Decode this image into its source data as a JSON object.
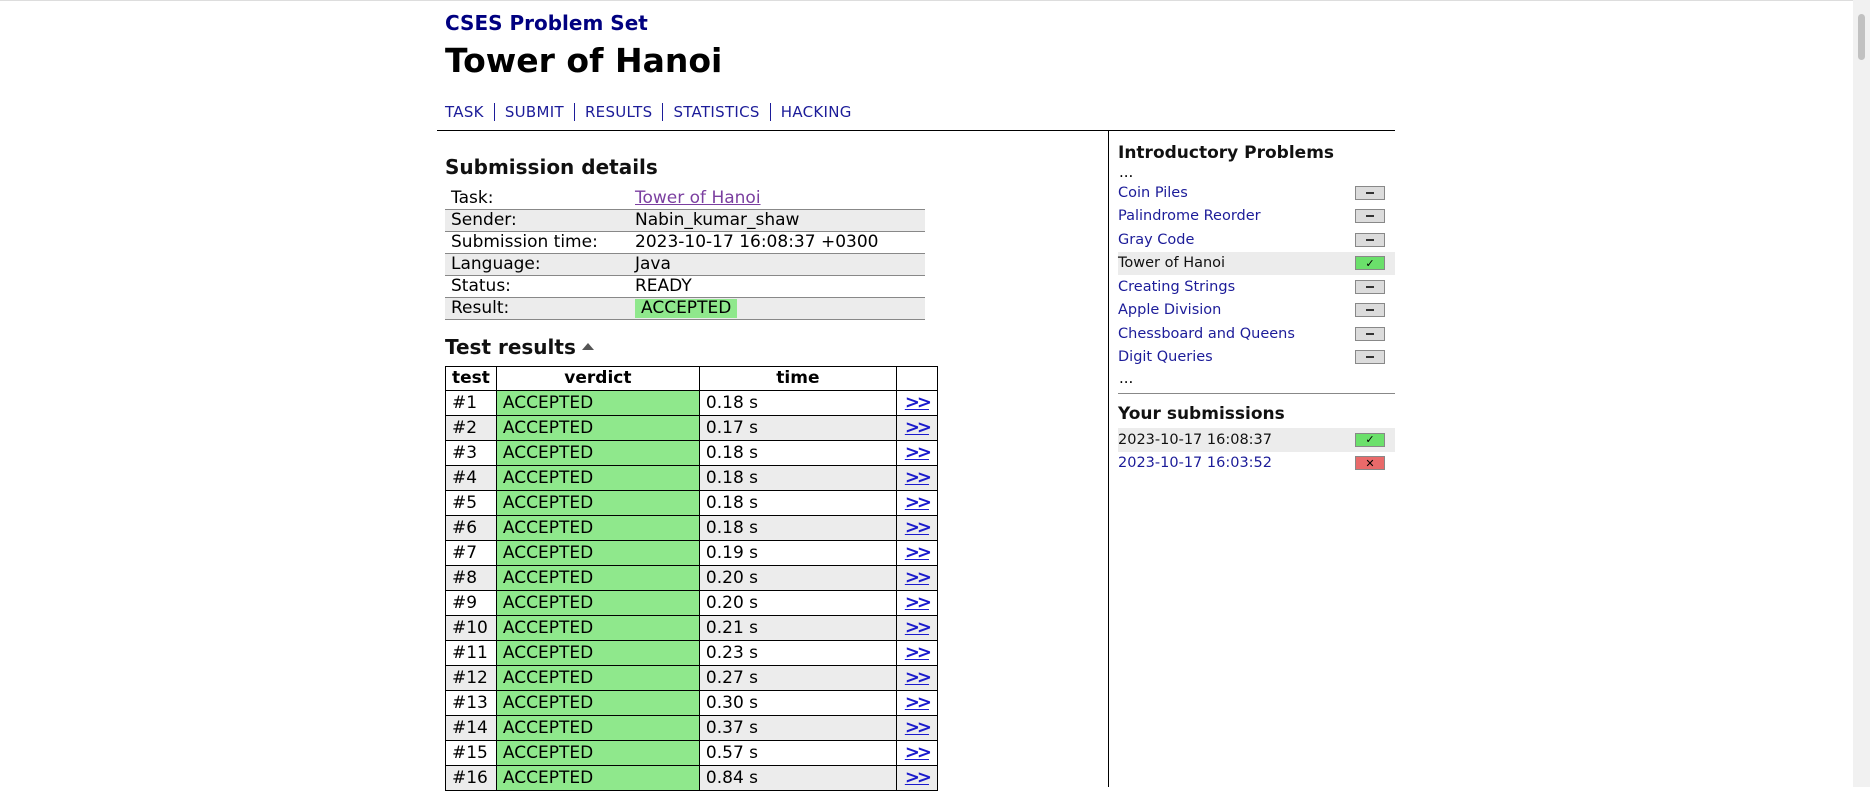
{
  "site": {
    "title": "CSES Problem Set"
  },
  "page": {
    "title": "Tower of Hanoi"
  },
  "nav": [
    "TASK",
    "SUBMIT",
    "RESULTS",
    "STATISTICS",
    "HACKING"
  ],
  "details": {
    "heading": "Submission details",
    "rows": [
      {
        "label": "Task:",
        "value": "Tower of Hanoi"
      },
      {
        "label": "Sender:",
        "value": "Nabin_kumar_shaw"
      },
      {
        "label": "Submission time:",
        "value": "2023-10-17 16:08:37 +0300"
      },
      {
        "label": "Language:",
        "value": "Java"
      },
      {
        "label": "Status:",
        "value": "READY"
      },
      {
        "label": "Result:",
        "value": "ACCEPTED"
      }
    ]
  },
  "tests": {
    "heading": "Test results",
    "columns": [
      "test",
      "verdict",
      "time",
      ""
    ],
    "more_icon": "double-chevron-right",
    "rows": [
      {
        "test": "#1",
        "verdict": "ACCEPTED",
        "time": "0.18 s"
      },
      {
        "test": "#2",
        "verdict": "ACCEPTED",
        "time": "0.17 s"
      },
      {
        "test": "#3",
        "verdict": "ACCEPTED",
        "time": "0.18 s"
      },
      {
        "test": "#4",
        "verdict": "ACCEPTED",
        "time": "0.18 s"
      },
      {
        "test": "#5",
        "verdict": "ACCEPTED",
        "time": "0.18 s"
      },
      {
        "test": "#6",
        "verdict": "ACCEPTED",
        "time": "0.18 s"
      },
      {
        "test": "#7",
        "verdict": "ACCEPTED",
        "time": "0.19 s"
      },
      {
        "test": "#8",
        "verdict": "ACCEPTED",
        "time": "0.20 s"
      },
      {
        "test": "#9",
        "verdict": "ACCEPTED",
        "time": "0.20 s"
      },
      {
        "test": "#10",
        "verdict": "ACCEPTED",
        "time": "0.21 s"
      },
      {
        "test": "#11",
        "verdict": "ACCEPTED",
        "time": "0.23 s"
      },
      {
        "test": "#12",
        "verdict": "ACCEPTED",
        "time": "0.27 s"
      },
      {
        "test": "#13",
        "verdict": "ACCEPTED",
        "time": "0.30 s"
      },
      {
        "test": "#14",
        "verdict": "ACCEPTED",
        "time": "0.37 s"
      },
      {
        "test": "#15",
        "verdict": "ACCEPTED",
        "time": "0.57 s"
      },
      {
        "test": "#16",
        "verdict": "ACCEPTED",
        "time": "0.84 s"
      }
    ]
  },
  "sidebar": {
    "section_title": "Introductory Problems",
    "ellipsis": "...",
    "problems": [
      {
        "name": "Coin Piles",
        "status": "none",
        "current": false
      },
      {
        "name": "Palindrome Reorder",
        "status": "none",
        "current": false
      },
      {
        "name": "Gray Code",
        "status": "none",
        "current": false
      },
      {
        "name": "Tower of Hanoi",
        "status": "full",
        "current": true
      },
      {
        "name": "Creating Strings",
        "status": "none",
        "current": false
      },
      {
        "name": "Apple Division",
        "status": "none",
        "current": false
      },
      {
        "name": "Chessboard and Queens",
        "status": "none",
        "current": false
      },
      {
        "name": "Digit Queries",
        "status": "none",
        "current": false
      }
    ],
    "submissions_title": "Your submissions",
    "submissions": [
      {
        "time": "2023-10-17 16:08:37",
        "status": "full",
        "current": true
      },
      {
        "time": "2023-10-17 16:03:52",
        "status": "zero",
        "current": false
      }
    ]
  },
  "colors": {
    "accepted": "#8fe88c",
    "tick_full": "#6be06b",
    "tick_zero": "#e96a6a",
    "link": "#1c1c99",
    "site_title": "#000080"
  },
  "icons": {
    "full": "✓",
    "zero": "✕",
    "sort": "triangle-up-icon"
  }
}
